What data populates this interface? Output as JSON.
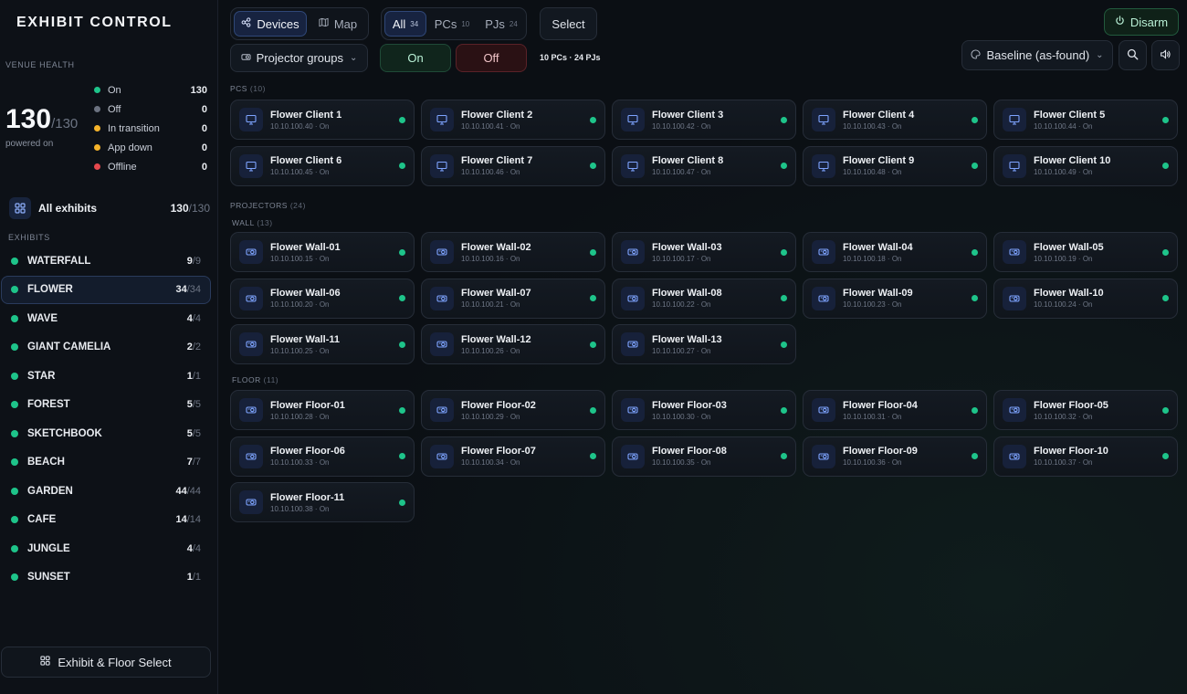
{
  "app": {
    "title": "EXHIBIT CONTROL"
  },
  "health": {
    "label": "VENUE HEALTH",
    "powered": "130",
    "total": "/130",
    "sub": "powered on",
    "legend": [
      {
        "label": "On",
        "value": "130",
        "color": "#1ec48a"
      },
      {
        "label": "Off",
        "value": "0",
        "color": "#6b7280"
      },
      {
        "label": "In transition",
        "value": "0",
        "color": "#f5b32a"
      },
      {
        "label": "App down",
        "value": "0",
        "color": "#f5b32a"
      },
      {
        "label": "Offline",
        "value": "0",
        "color": "#e5484d"
      }
    ]
  },
  "all_exhibits": {
    "label": "All exhibits",
    "count": "130",
    "total": "/130"
  },
  "exhibits_label": "EXHIBITS",
  "exhibits": [
    {
      "name": "WATERFALL",
      "count": "9",
      "total": "/9"
    },
    {
      "name": "FLOWER",
      "count": "34",
      "total": "/34",
      "active": true
    },
    {
      "name": "WAVE",
      "count": "4",
      "total": "/4"
    },
    {
      "name": "GIANT CAMELIA",
      "count": "2",
      "total": "/2"
    },
    {
      "name": "STAR",
      "count": "1",
      "total": "/1"
    },
    {
      "name": "FOREST",
      "count": "5",
      "total": "/5"
    },
    {
      "name": "SKETCHBOOK",
      "count": "5",
      "total": "/5"
    },
    {
      "name": "BEACH",
      "count": "7",
      "total": "/7"
    },
    {
      "name": "GARDEN",
      "count": "44",
      "total": "/44"
    },
    {
      "name": "CAFE",
      "count": "14",
      "total": "/14"
    },
    {
      "name": "JUNGLE",
      "count": "4",
      "total": "/4"
    },
    {
      "name": "SUNSET",
      "count": "1",
      "total": "/1"
    }
  ],
  "floor_select": {
    "label": "Exhibit & Floor Select"
  },
  "toolbar": {
    "devices": "Devices",
    "map": "Map",
    "filters": [
      {
        "label": "All",
        "count": "34"
      },
      {
        "label": "PCs",
        "count": "10"
      },
      {
        "label": "PJs",
        "count": "24"
      }
    ],
    "select": "Select",
    "disarm": "Disarm",
    "projector_groups": "Projector groups",
    "on": "On",
    "off": "Off",
    "summary": "10 PCs · 24 PJs",
    "baseline": "Baseline (as-found)"
  },
  "groups": {
    "pcs": {
      "label": "PCS",
      "count": "(10)"
    },
    "projectors": {
      "label": "PROJECTORS",
      "count": "(24)"
    },
    "wall": {
      "label": "WALL",
      "count": "(13)"
    },
    "floor": {
      "label": "FLOOR",
      "count": "(11)"
    }
  },
  "pcs": [
    {
      "name": "Flower Client 1",
      "meta": "10.10.100.40 · On"
    },
    {
      "name": "Flower Client 2",
      "meta": "10.10.100.41 · On"
    },
    {
      "name": "Flower Client 3",
      "meta": "10.10.100.42 · On"
    },
    {
      "name": "Flower Client 4",
      "meta": "10.10.100.43 · On"
    },
    {
      "name": "Flower Client 5",
      "meta": "10.10.100.44 · On"
    },
    {
      "name": "Flower Client 6",
      "meta": "10.10.100.45 · On"
    },
    {
      "name": "Flower Client 7",
      "meta": "10.10.100.46 · On"
    },
    {
      "name": "Flower Client 8",
      "meta": "10.10.100.47 · On"
    },
    {
      "name": "Flower Client 9",
      "meta": "10.10.100.48 · On"
    },
    {
      "name": "Flower Client 10",
      "meta": "10.10.100.49 · On"
    }
  ],
  "walls": [
    {
      "name": "Flower Wall-01",
      "meta": "10.10.100.15 · On"
    },
    {
      "name": "Flower Wall-02",
      "meta": "10.10.100.16 · On"
    },
    {
      "name": "Flower Wall-03",
      "meta": "10.10.100.17 · On"
    },
    {
      "name": "Flower Wall-04",
      "meta": "10.10.100.18 · On"
    },
    {
      "name": "Flower Wall-05",
      "meta": "10.10.100.19 · On"
    },
    {
      "name": "Flower Wall-06",
      "meta": "10.10.100.20 · On"
    },
    {
      "name": "Flower Wall-07",
      "meta": "10.10.100.21 · On"
    },
    {
      "name": "Flower Wall-08",
      "meta": "10.10.100.22 · On"
    },
    {
      "name": "Flower Wall-09",
      "meta": "10.10.100.23 · On"
    },
    {
      "name": "Flower Wall-10",
      "meta": "10.10.100.24 · On"
    },
    {
      "name": "Flower Wall-11",
      "meta": "10.10.100.25 · On"
    },
    {
      "name": "Flower Wall-12",
      "meta": "10.10.100.26 · On"
    },
    {
      "name": "Flower Wall-13",
      "meta": "10.10.100.27 · On"
    }
  ],
  "floors": [
    {
      "name": "Flower Floor-01",
      "meta": "10.10.100.28 · On"
    },
    {
      "name": "Flower Floor-02",
      "meta": "10.10.100.29 · On"
    },
    {
      "name": "Flower Floor-03",
      "meta": "10.10.100.30 · On"
    },
    {
      "name": "Flower Floor-04",
      "meta": "10.10.100.31 · On"
    },
    {
      "name": "Flower Floor-05",
      "meta": "10.10.100.32 · On"
    },
    {
      "name": "Flower Floor-06",
      "meta": "10.10.100.33 · On"
    },
    {
      "name": "Flower Floor-07",
      "meta": "10.10.100.34 · On"
    },
    {
      "name": "Flower Floor-08",
      "meta": "10.10.100.35 · On"
    },
    {
      "name": "Flower Floor-09",
      "meta": "10.10.100.36 · On"
    },
    {
      "name": "Flower Floor-10",
      "meta": "10.10.100.37 · On"
    },
    {
      "name": "Flower Floor-11",
      "meta": "10.10.100.38 · On"
    }
  ],
  "icons": {
    "devices": "share-nodes-icon",
    "map": "map-icon",
    "pc": "monitor-icon",
    "projector": "projector-icon",
    "power": "power-icon",
    "palette": "palette-icon",
    "search": "search-icon",
    "volume": "volume-icon",
    "grid": "grid-icon"
  },
  "colors": {
    "accent": "#2f4777",
    "status_on": "#1ec48a",
    "off_button": "#2a1114",
    "on_button": "#10251c"
  }
}
